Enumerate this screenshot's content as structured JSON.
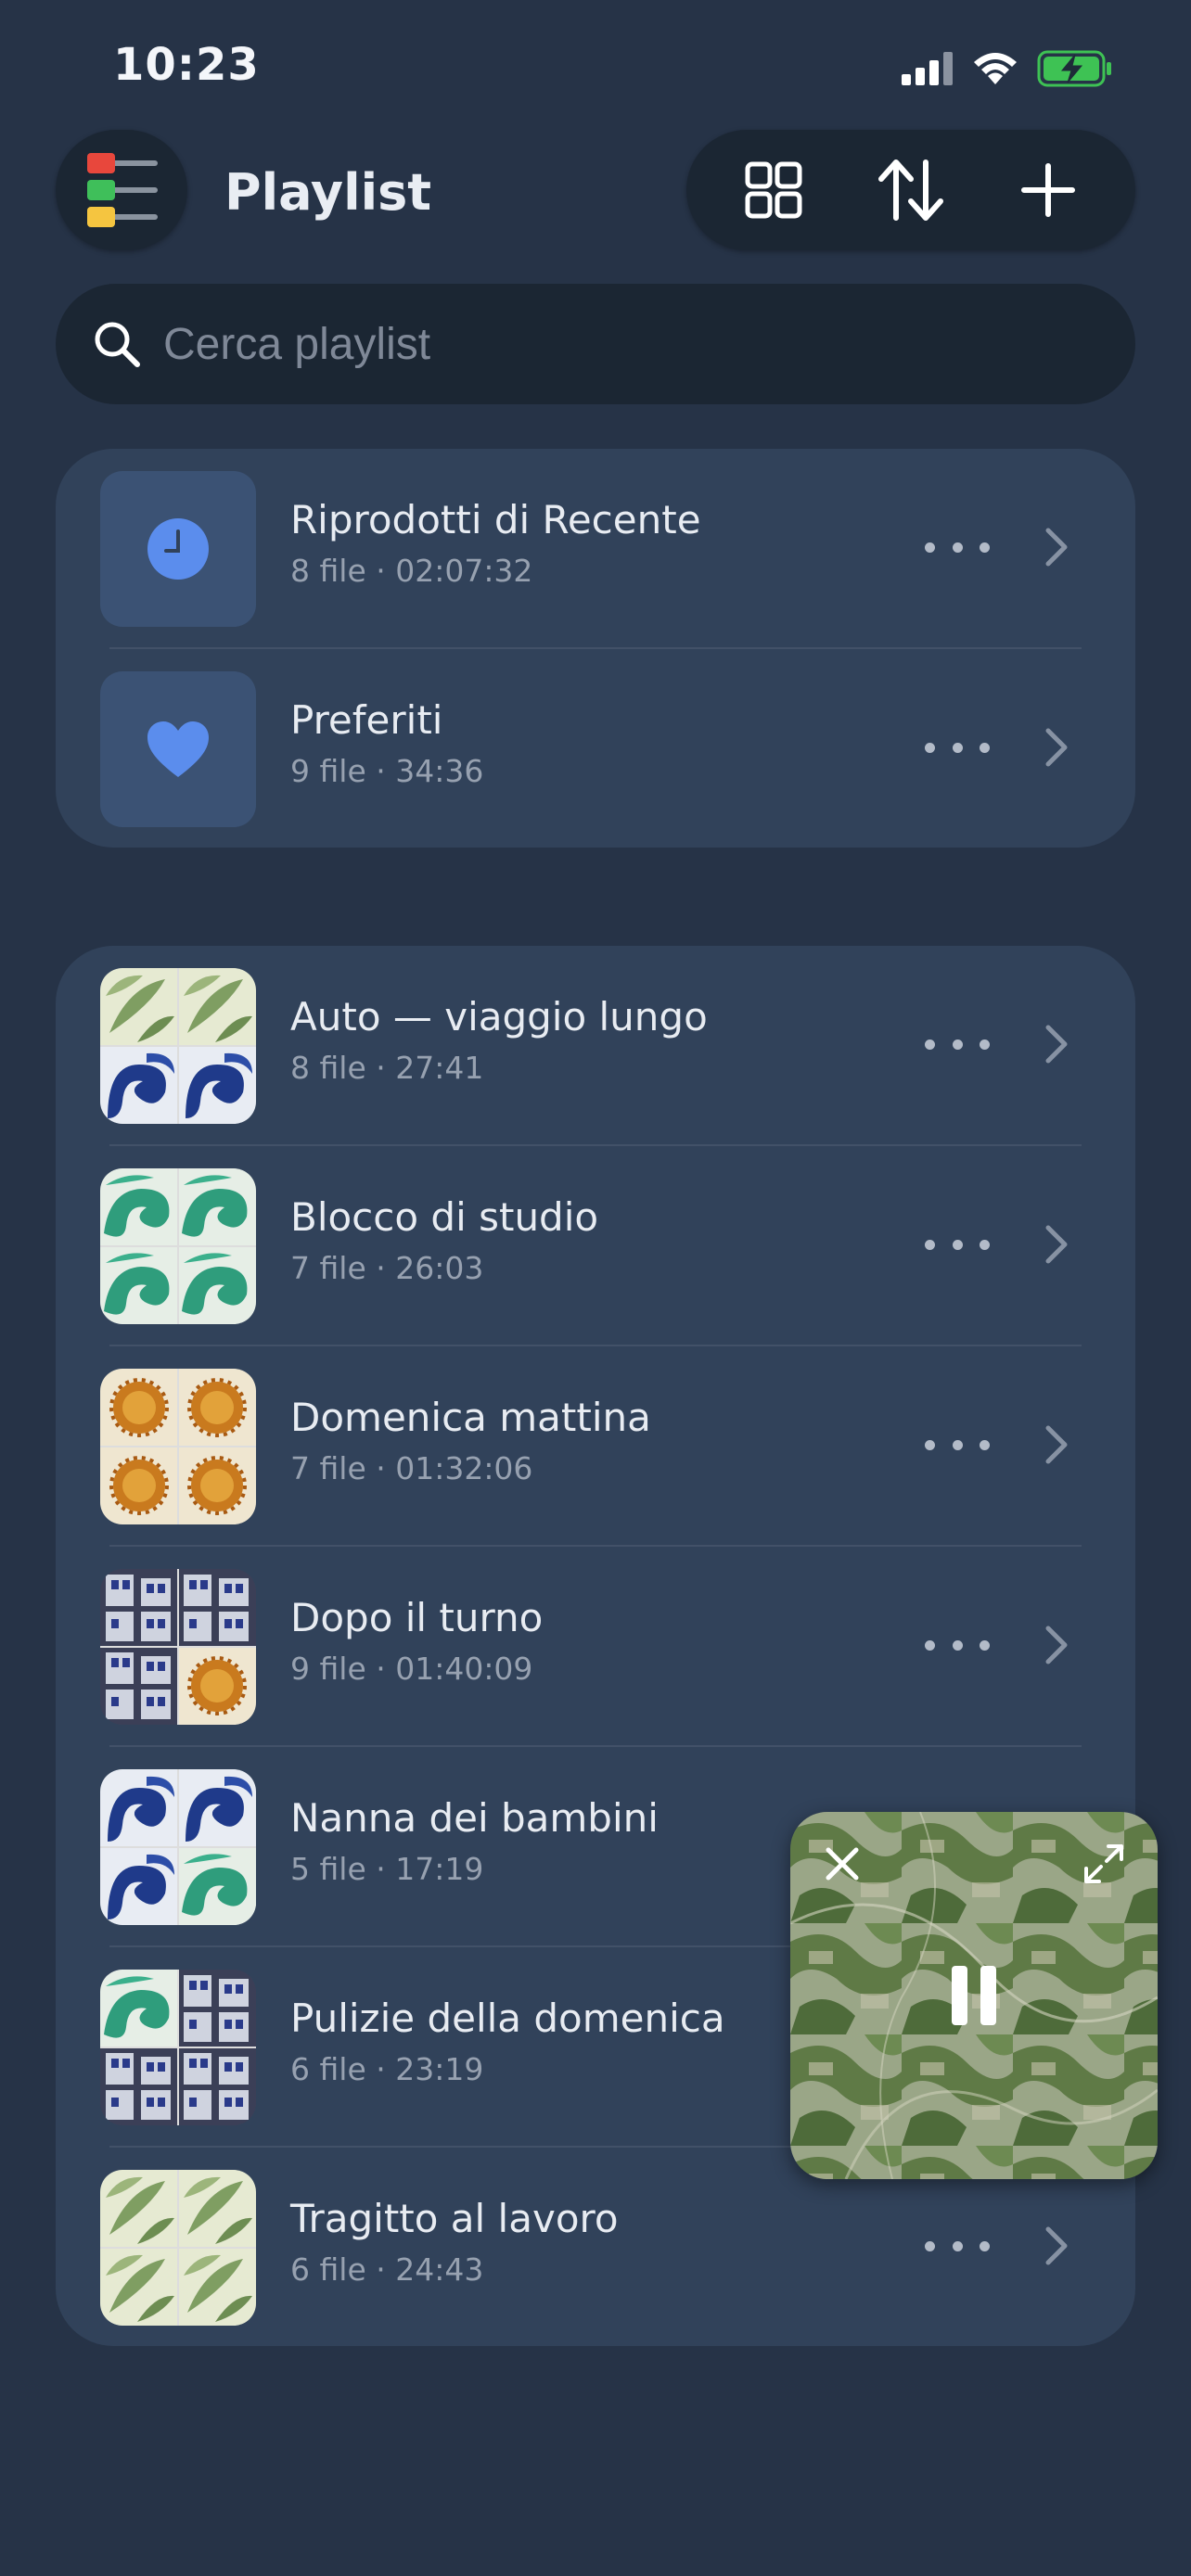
{
  "status": {
    "time": "10:23"
  },
  "header": {
    "title": "Playlist"
  },
  "search": {
    "placeholder": "Cerca playlist"
  },
  "pinned": [
    {
      "title": "Riprodotti di Recente",
      "subtitle": "8 file · 02:07:32",
      "icon": "clock-icon"
    },
    {
      "title": "Preferiti",
      "subtitle": "9 file · 34:36",
      "icon": "heart-icon"
    }
  ],
  "playlists": [
    {
      "title": "Auto — viaggio lungo",
      "subtitle": "8 file · 27:41",
      "art": "leaves-waves"
    },
    {
      "title": "Blocco di studio",
      "subtitle": "7 file · 26:03",
      "art": "green-waves"
    },
    {
      "title": "Domenica mattina",
      "subtitle": "7 file · 01:32:06",
      "art": "suns"
    },
    {
      "title": "Dopo il turno",
      "subtitle": "9 file · 01:40:09",
      "art": "buildings-sun"
    },
    {
      "title": "Nanna dei bambini",
      "subtitle": "5 file · 17:19",
      "art": "blue-green-waves"
    },
    {
      "title": "Pulizie della domenica",
      "subtitle": "6 file · 23:19",
      "art": "waves-buildings"
    },
    {
      "title": "Tragitto al lavoro",
      "subtitle": "6 file · 24:43",
      "art": "leaves"
    }
  ],
  "colors": {
    "background": "#263347",
    "card": "#31425a",
    "accent": "#5b8ded",
    "battery": "#3ec254"
  }
}
